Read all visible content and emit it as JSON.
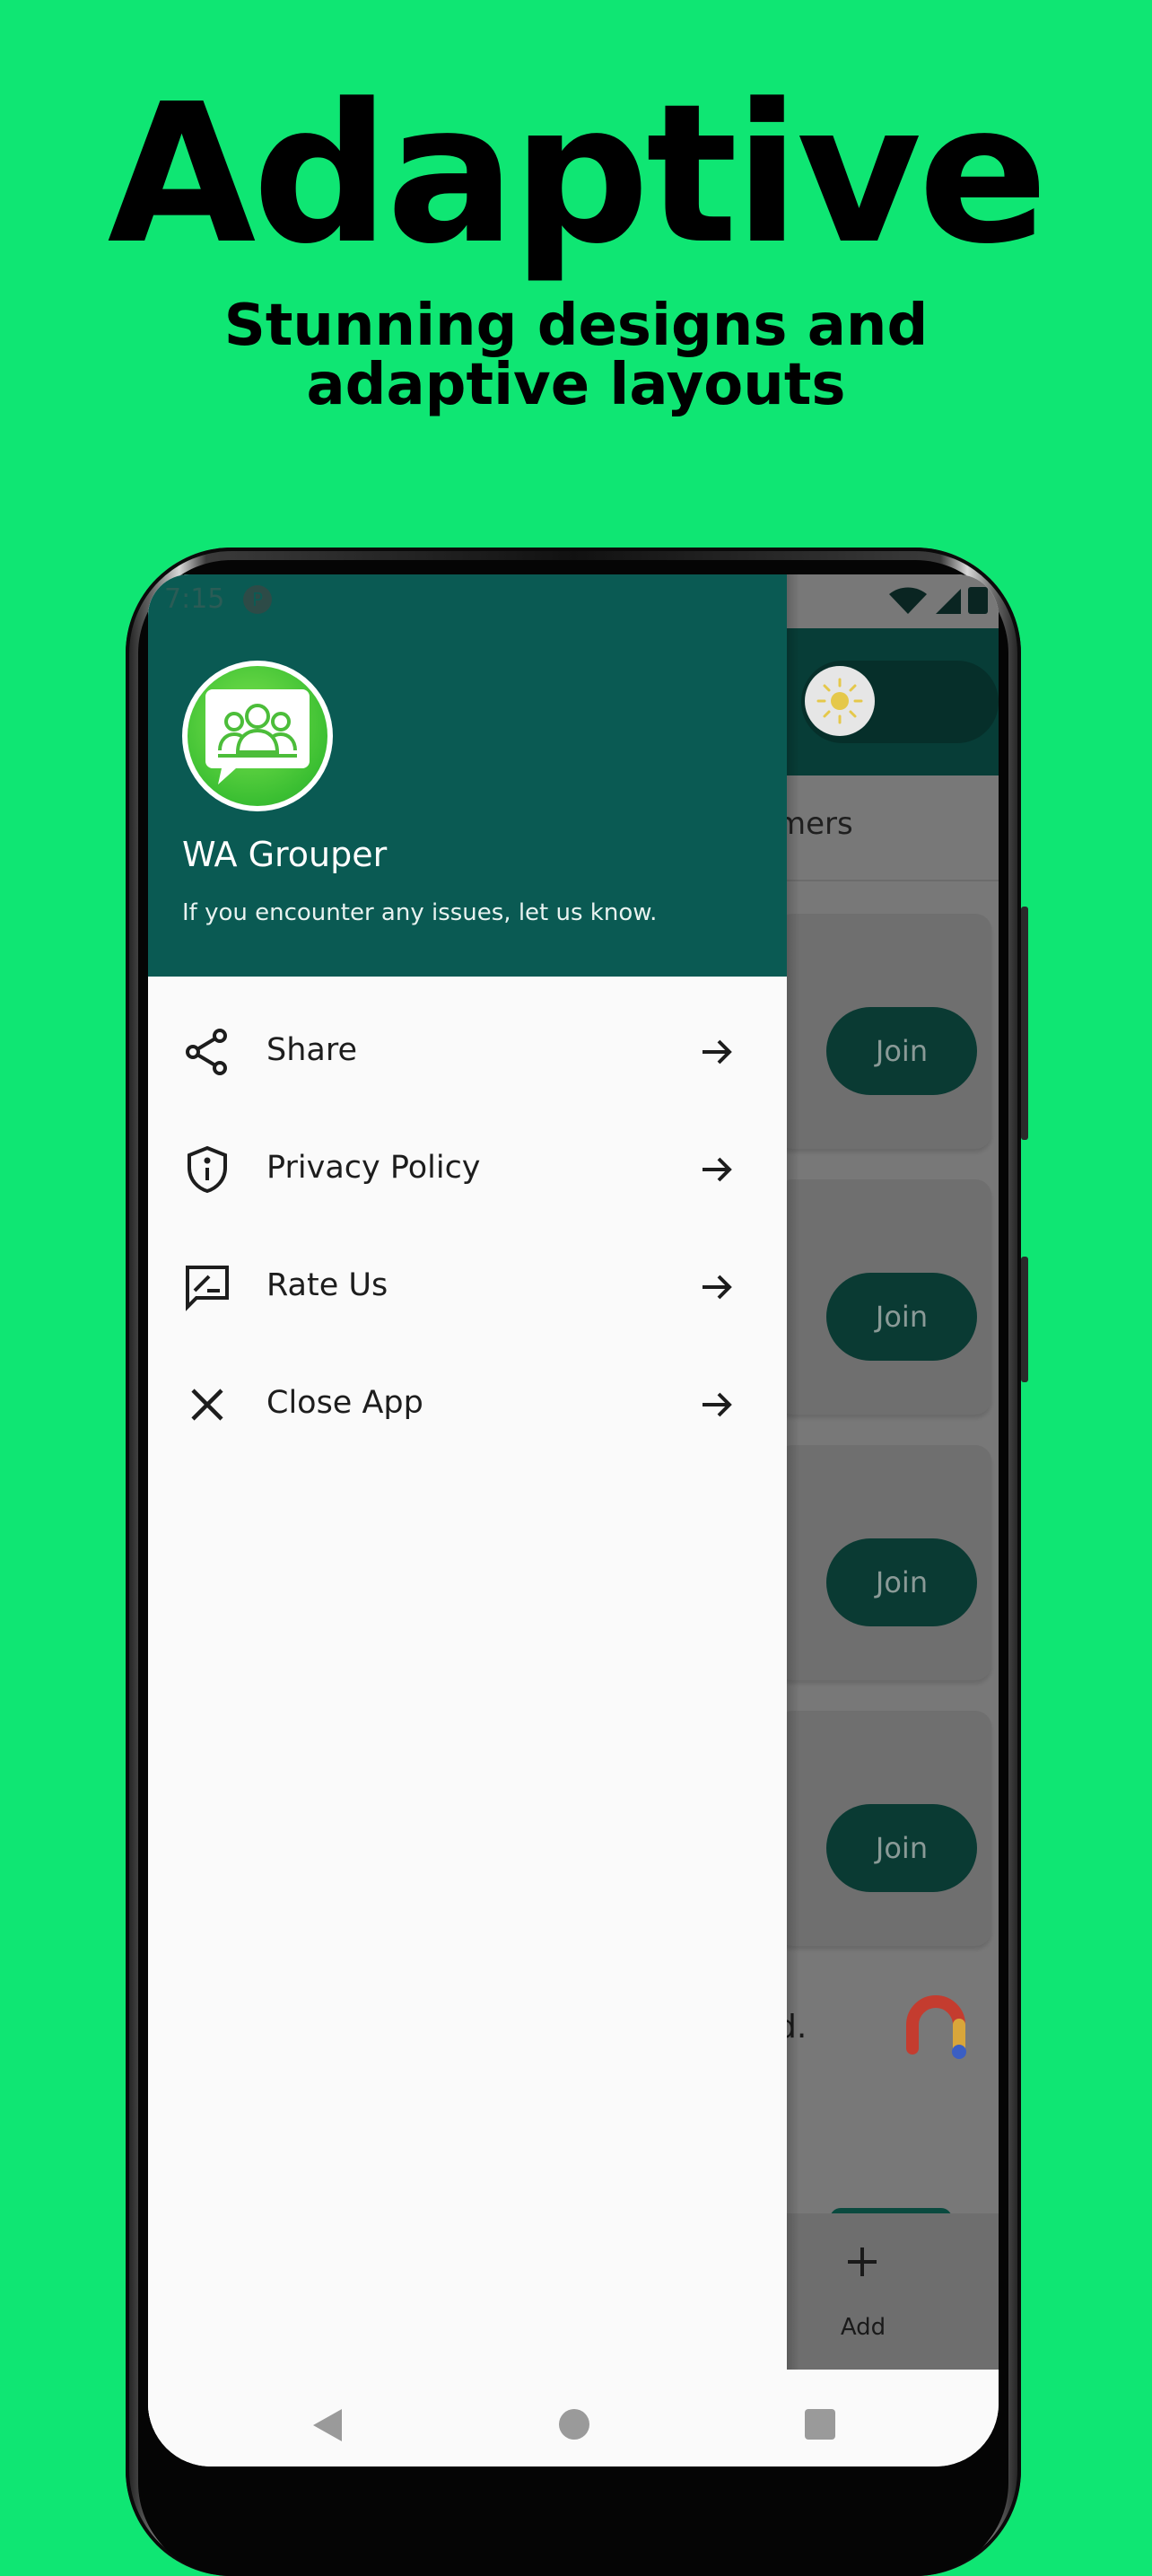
{
  "promo": {
    "title": "Adaptive",
    "subtitle": "Stunning designs and adaptive layouts"
  },
  "status_bar": {
    "time": "7:15",
    "notification_glyph": "P"
  },
  "drawer": {
    "app_name": "WA Grouper",
    "subtitle": "If you encounter any issues, let us know.",
    "menu": [
      {
        "label": "Share",
        "icon": "share-icon"
      },
      {
        "label": "Privacy Policy",
        "icon": "shield-info-icon"
      },
      {
        "label": "Rate Us",
        "icon": "rate-review-icon"
      },
      {
        "label": "Close App",
        "icon": "close-icon"
      }
    ]
  },
  "background_app": {
    "tab_partial": "mers",
    "join_labels": [
      "Join",
      "Join",
      "Join",
      "Join"
    ],
    "ad_text_partial": "d.",
    "bottom_nav_add": "Add"
  },
  "colors": {
    "page_background": "#0fe673",
    "drawer_header": "#0a5a53",
    "join_button": "#0a3a33"
  }
}
